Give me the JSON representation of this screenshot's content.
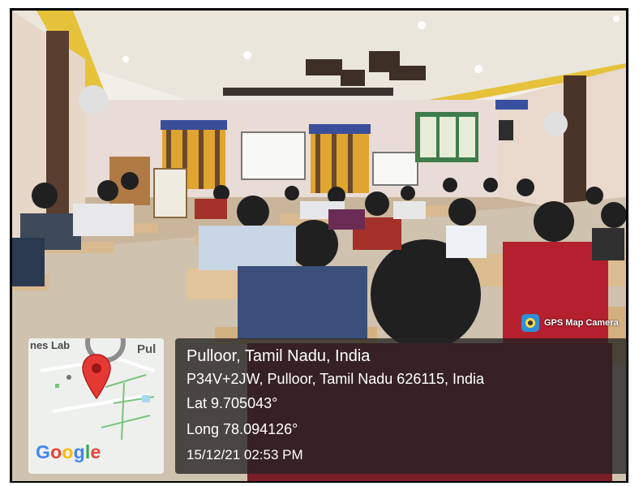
{
  "camera_badge": {
    "label": "GPS Map Camera",
    "icon": "gps-camera-icon"
  },
  "location": {
    "place": "Pulloor, Tamil Nadu, India",
    "address": "P34V+2JW, Pulloor, Tamil Nadu 626115, India",
    "latitude": "Lat 9.705043°",
    "longitude": "Long 78.094126°",
    "datetime": "15/12/21 02:53 PM"
  },
  "map": {
    "label_top_left": "nes Lab",
    "label_top_right": "Pul",
    "brand": [
      "G",
      "o",
      "o",
      "g",
      "l",
      "e"
    ],
    "pin_color": "#e53935"
  }
}
